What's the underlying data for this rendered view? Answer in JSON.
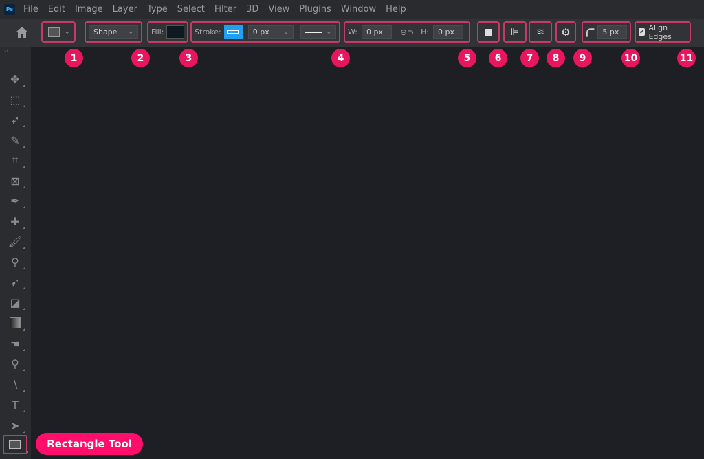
{
  "app": {
    "logo": "Ps"
  },
  "menu": [
    "File",
    "Edit",
    "Image",
    "Layer",
    "Type",
    "Select",
    "Filter",
    "3D",
    "View",
    "Plugins",
    "Window",
    "Help"
  ],
  "options": {
    "shape_mode": "Shape",
    "fill_label": "Fill:",
    "fill_color": "#0d1a1f",
    "stroke_label": "Stroke:",
    "stroke_color": "#1fa0f0",
    "stroke_width": "0 px",
    "w_label": "W:",
    "w_value": "0 px",
    "h_label": "H:",
    "h_value": "0 px",
    "corner_radius": "5 px",
    "align_edges_label": "Align Edges",
    "align_edges_checked": true
  },
  "badges": [
    "1",
    "2",
    "3",
    "4",
    "5",
    "6",
    "7",
    "8",
    "9",
    "10",
    "11"
  ],
  "tools": [
    "move",
    "marquee",
    "lasso",
    "quick-selection",
    "crop",
    "frame",
    "eyedropper",
    "healing",
    "brush",
    "stamp",
    "history-brush",
    "eraser",
    "gradient",
    "smudge",
    "dodge",
    "pen",
    "type",
    "path-selection",
    "rectangle"
  ],
  "tool_label": "Rectangle Tool",
  "accent": "#e8175d"
}
